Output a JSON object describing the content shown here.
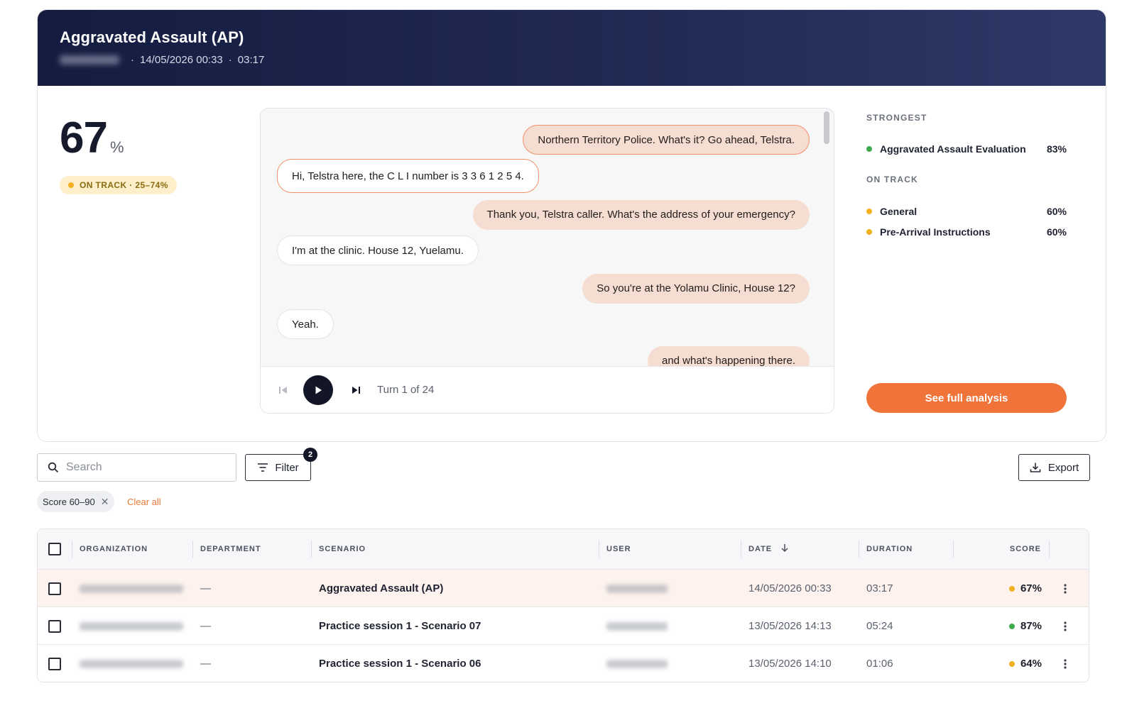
{
  "header": {
    "title": "Aggravated Assault (AP)",
    "date": "14/05/2026 00:33",
    "duration": "03:17"
  },
  "score": {
    "value": "67",
    "unit": "%",
    "badge": "ON TRACK · 25–74%"
  },
  "transcript": {
    "messages": [
      {
        "side": "out",
        "text": "Northern Territory Police. What's it? Go ahead, Telstra."
      },
      {
        "side": "in",
        "text": "Hi, Telstra here, the C L I number is 3 3 6 1 2 5 4."
      },
      {
        "side": "out",
        "text": "Thank you, Telstra caller. What's the address of your emergency?"
      },
      {
        "side": "in",
        "text": "I'm at the clinic. House 12, Yuelamu."
      },
      {
        "side": "out",
        "text": "So you're at the Yolamu Clinic, House 12?"
      },
      {
        "side": "in",
        "text": "Yeah."
      },
      {
        "side": "out",
        "text": "and what's happening there."
      }
    ],
    "turn_label": "Turn 1 of 24"
  },
  "side_panel": {
    "strongest_heading": "STRONGEST",
    "strongest": [
      {
        "name": "Aggravated Assault Evaluation",
        "value": "83%",
        "color": "#3faa4c"
      }
    ],
    "on_track_heading": "ON TRACK",
    "on_track": [
      {
        "name": "General",
        "value": "60%",
        "color": "#f2b01e"
      },
      {
        "name": "Pre-Arrival Instructions",
        "value": "60%",
        "color": "#f2b01e"
      }
    ],
    "cta_label": "See full analysis"
  },
  "toolbar": {
    "search_placeholder": "Search",
    "filter_label": "Filter",
    "filter_count": "2",
    "export_label": "Export",
    "chip_label": "Score 60–90",
    "clear_label": "Clear all"
  },
  "table": {
    "columns": [
      "ORGANIZATION",
      "DEPARTMENT",
      "SCENARIO",
      "USER",
      "DATE",
      "DURATION",
      "SCORE"
    ],
    "rows": [
      {
        "department": "—",
        "scenario": "Aggravated Assault (AP)",
        "date": "14/05/2026 00:33",
        "duration": "03:17",
        "score": "67%",
        "color": "#f2b01e"
      },
      {
        "department": "—",
        "scenario": "Practice session 1 - Scenario 07",
        "date": "13/05/2026 14:13",
        "duration": "05:24",
        "score": "87%",
        "color": "#3faa4c"
      },
      {
        "department": "—",
        "scenario": "Practice session 1 - Scenario 06",
        "date": "13/05/2026 14:10",
        "duration": "01:06",
        "score": "64%",
        "color": "#f2b01e"
      }
    ]
  },
  "colors": {
    "accent": "#f0743a",
    "header_bg": "#1c2450",
    "green": "#3faa4c",
    "amber": "#f2b01e"
  }
}
